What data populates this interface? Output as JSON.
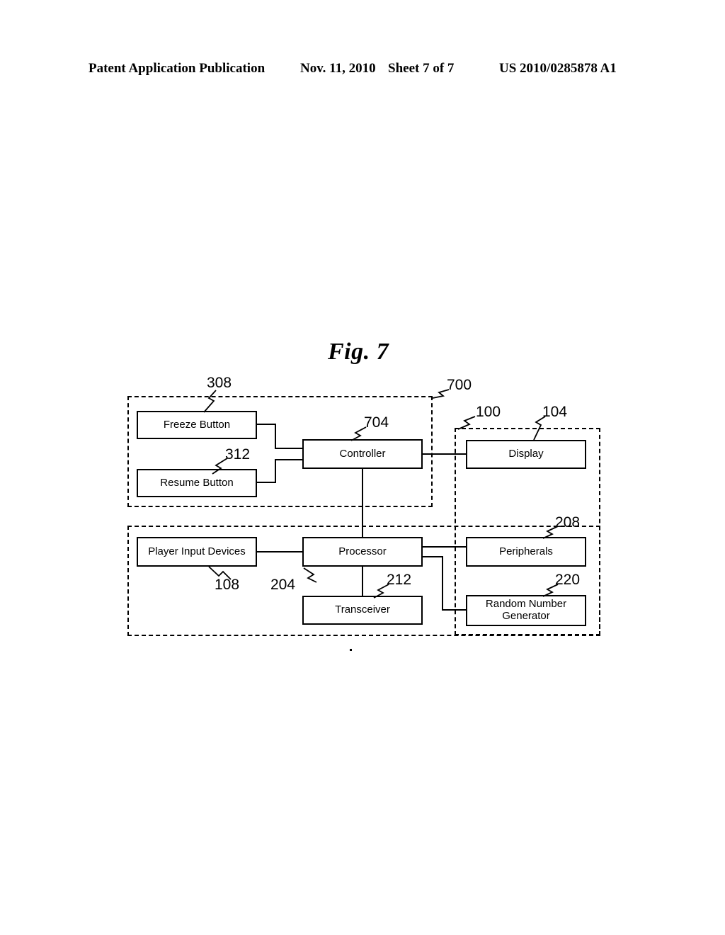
{
  "header": {
    "publication": "Patent Application Publication",
    "date": "Nov. 11, 2010",
    "sheet": "Sheet 7 of 7",
    "patent_number": "US 2010/0285878 A1"
  },
  "figure": {
    "title": "Fig. 7",
    "nodes": [
      {
        "id": "freeze",
        "label": "Freeze Button",
        "ref": "308"
      },
      {
        "id": "resume",
        "label": "Resume Button",
        "ref": "312"
      },
      {
        "id": "controller",
        "label": "Controller",
        "ref": "704"
      },
      {
        "id": "display",
        "label": "Display",
        "ref": "104"
      },
      {
        "id": "player",
        "label": "Player Input Devices",
        "ref": "108"
      },
      {
        "id": "processor",
        "label": "Processor",
        "ref": "204"
      },
      {
        "id": "transceiver",
        "label": "Transceiver",
        "ref": "212"
      },
      {
        "id": "peripherals",
        "label": "Peripherals",
        "ref": "208"
      },
      {
        "id": "rng_line1",
        "label": "Random Number",
        "ref": "220"
      },
      {
        "id": "rng_line2",
        "label": "Generator",
        "ref": ""
      }
    ],
    "groups": [
      {
        "id": "group_700",
        "ref": "700"
      },
      {
        "id": "group_100",
        "ref": "100"
      },
      {
        "id": "group_lower",
        "ref": ""
      }
    ],
    "refs": {
      "r308": "308",
      "r312": "312",
      "r700": "700",
      "r704": "704",
      "r100": "100",
      "r104": "104",
      "r108": "108",
      "r204": "204",
      "r208": "208",
      "r212": "212",
      "r220": "220"
    },
    "rng_label_line1": "Random Number",
    "rng_label_line2": "Generator"
  },
  "colors": {
    "ink": "#000000",
    "paper": "#ffffff"
  }
}
